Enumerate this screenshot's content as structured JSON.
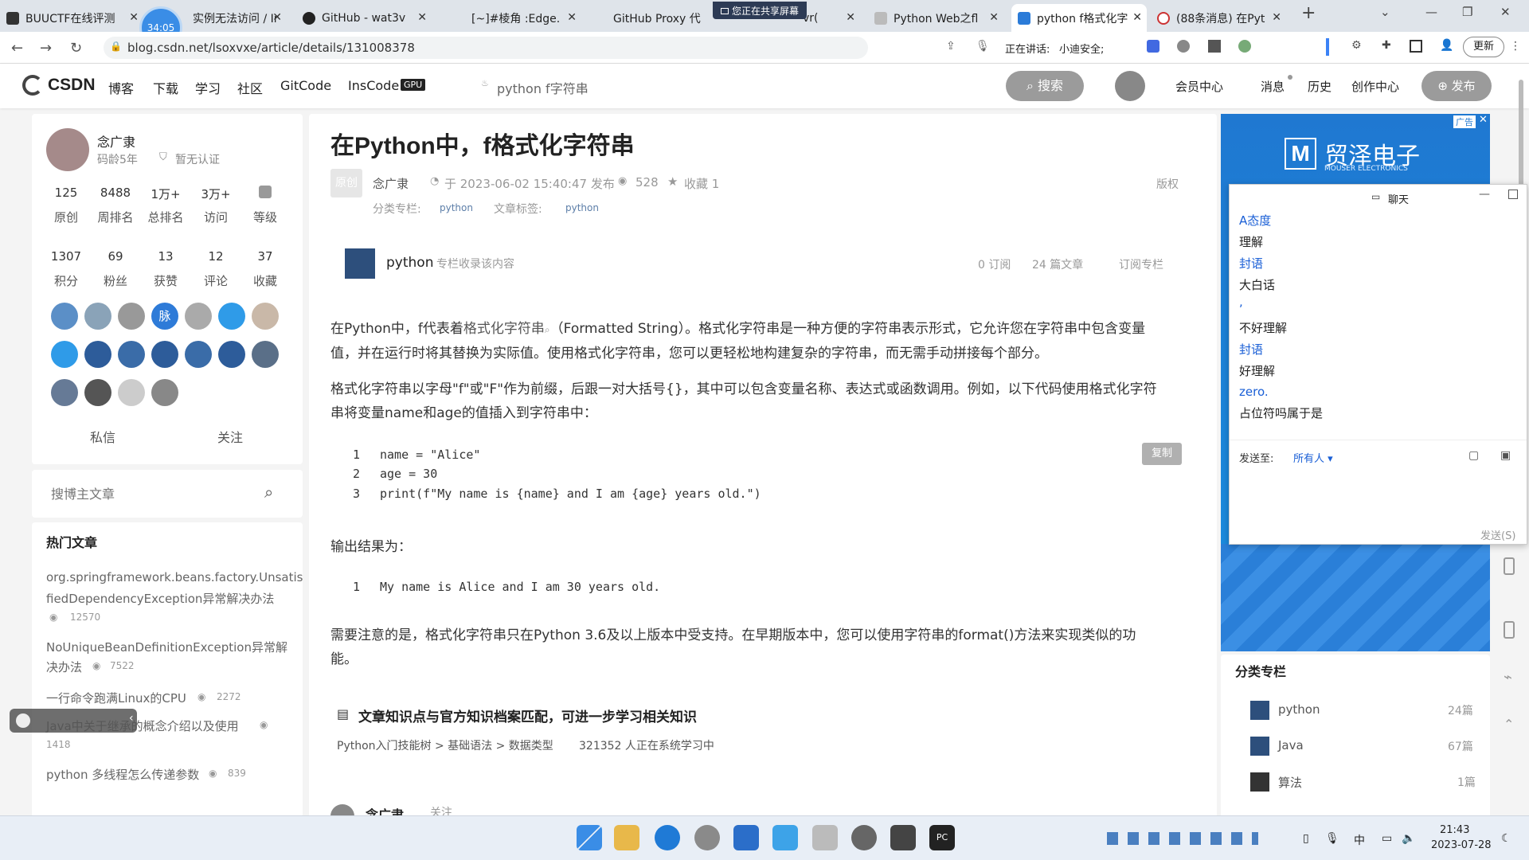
{
  "browser": {
    "tabs": [
      {
        "label": "BUUCTF在线评测"
      },
      {
        "label": "实例无法访问 / Ir"
      },
      {
        "label": "GitHub - wat3v"
      },
      {
        "label": "[~]#棱角 :Edge."
      },
      {
        "label": "GitHub Proxy 代"
      },
      {
        "label": "vr("
      },
      {
        "label": "Python Web之fl"
      },
      {
        "label": "python f格式化字"
      },
      {
        "label": "(88条消息) 在Pyt"
      }
    ],
    "timer": "34:05",
    "sharing_banner": "您正在共享屏幕",
    "url": "blog.csdn.net/lsoxvxe/article/details/131008378",
    "speaking_label": "正在讲话:",
    "speaking_name": "小迪安全;",
    "update_label": "更新"
  },
  "csdn_nav": {
    "logo": "CSDN",
    "links": [
      "博客",
      "下载",
      "学习",
      "社区",
      "GitCode",
      "InsCode"
    ],
    "gpu_badge": "GPU",
    "search_hint": "python f字符串",
    "search_button": "搜索",
    "right_links": [
      "会员中心",
      "消息",
      "历史",
      "创作中心"
    ],
    "publish_button": "发布"
  },
  "profile": {
    "name": "念广隶",
    "years": "码龄5年",
    "verify": "暂无认证",
    "stats_row1": [
      {
        "num": "125",
        "label": "原创"
      },
      {
        "num": "8488",
        "label": "周排名"
      },
      {
        "num": "1万+",
        "label": "总排名"
      },
      {
        "num": "3万+",
        "label": "访问"
      },
      {
        "num": "",
        "label": "等级"
      }
    ],
    "stats_row2": [
      {
        "num": "1307",
        "label": "积分"
      },
      {
        "num": "69",
        "label": "粉丝"
      },
      {
        "num": "13",
        "label": "获赞"
      },
      {
        "num": "12",
        "label": "评论"
      },
      {
        "num": "37",
        "label": "收藏"
      }
    ],
    "badge_center_text": "脉",
    "message_button": "私信",
    "follow_button": "关注"
  },
  "search_blog": {
    "placeholder": "搜博主文章"
  },
  "hot_articles": {
    "title": "热门文章",
    "items": [
      {
        "title_l1": "org.springframework.beans.factory.Unsatis",
        "title_l2": "fiedDependencyException异常解决办法",
        "views": "12570"
      },
      {
        "title_l1": "NoUniqueBeanDefinitionException异常解",
        "title_l2": "决办法",
        "views": "7522"
      },
      {
        "title_l1": "一行命令跑满Linux的CPU",
        "title_l2": "",
        "views": "2272"
      },
      {
        "title_l1": "Java中关于继承的概念介绍以及使用",
        "title_l2": "",
        "views": "1418"
      },
      {
        "title_l1": "python 多线程怎么传递参数",
        "title_l2": "",
        "views": "839"
      }
    ]
  },
  "article": {
    "title": "在Python中，f格式化字符串",
    "orig_tag": "原创",
    "author": "念广隶",
    "date": "于 2023-06-02 15:40:47 发布",
    "views": "528",
    "collect": "收藏 1",
    "copyright": "版权",
    "category_label": "分类专栏:",
    "category": "python",
    "tags_label": "文章标签:",
    "tag": "python",
    "column_name": "python",
    "column_desc": "专栏收录该内容",
    "subs": "0 订阅",
    "articles": "24 篇文章",
    "subscribe": "订阅专栏",
    "p1_l1_a": "在Python中，f代表着",
    "p1_l1_link": "格式化字符串",
    "p1_l1_b": "（Formatted String）。格式化字符串是一种方便的字符串表示形式，它允许您在字符串中包含变量",
    "p1_l2": "值，并在运行时将其替换为实际值。使用格式化字符串，您可以更轻松地构建复杂的字符串，而无需手动拼接每个部分。",
    "p2_l1": "格式化字符串以字母\"f\"或\"F\"作为前缀，后跟一对大括号{}，其中可以包含变量名称、表达式或函数调用。例如，以下代码使用格式化字符",
    "p2_l2": "串将变量name和age的值插入到字符串中：",
    "copy_button": "复制",
    "code_lines": [
      {
        "n": "1",
        "text": "name = \"Alice\""
      },
      {
        "n": "2",
        "text": "age = 30"
      },
      {
        "n": "3",
        "text": "print(f\"My name is {name} and I am {age} years old.\")"
      }
    ],
    "output_label": "输出结果为：",
    "output_lines": [
      {
        "n": "1",
        "text": "My name is Alice and I am 30 years old."
      }
    ],
    "p3_l1": "需要注意的是，格式化字符串只在Python 3.6及以上版本中受支持。在早期版本中，您可以使用字符串的format()方法来实现类似的功",
    "p3_l2": "能。",
    "knowledge_title": "文章知识点与官方知识档案匹配，可进一步学习相关知识",
    "knowledge_path": "Python入门技能树 > 基础语法 > 数据类型",
    "knowledge_count": "321352 人正在系统学习中",
    "footer_author": "念广隶",
    "footer_follow": "关注"
  },
  "ad": {
    "label": "广告",
    "brand": "贸泽电子",
    "sub": "MOUSER ELECTRONICS"
  },
  "chat": {
    "title": "聊天",
    "messages": [
      {
        "from": "A态度",
        "text": "理解"
      },
      {
        "from": "封语",
        "text": "大白话"
      },
      {
        "from": ",",
        "text": "不好理解"
      },
      {
        "from": "封语",
        "text": "好理解"
      },
      {
        "from": "zero.",
        "text": "占位符吗属于是"
      }
    ],
    "send_to_label": "发送至:",
    "send_to_value": "所有人",
    "send_button": "发送(S)"
  },
  "right_columns": {
    "title": "分类专栏",
    "items": [
      {
        "name": "python",
        "count": "24篇"
      },
      {
        "name": "Java",
        "count": "67篇"
      },
      {
        "name": "算法",
        "count": "1篇"
      }
    ]
  },
  "taskbar": {
    "ime": "中",
    "time": "21:43",
    "date": "2023-07-28"
  },
  "colors": {
    "brand_red": "#fc5531",
    "link_blue": "#1a5fd6",
    "taskbar_bg": "#e8eef6"
  }
}
